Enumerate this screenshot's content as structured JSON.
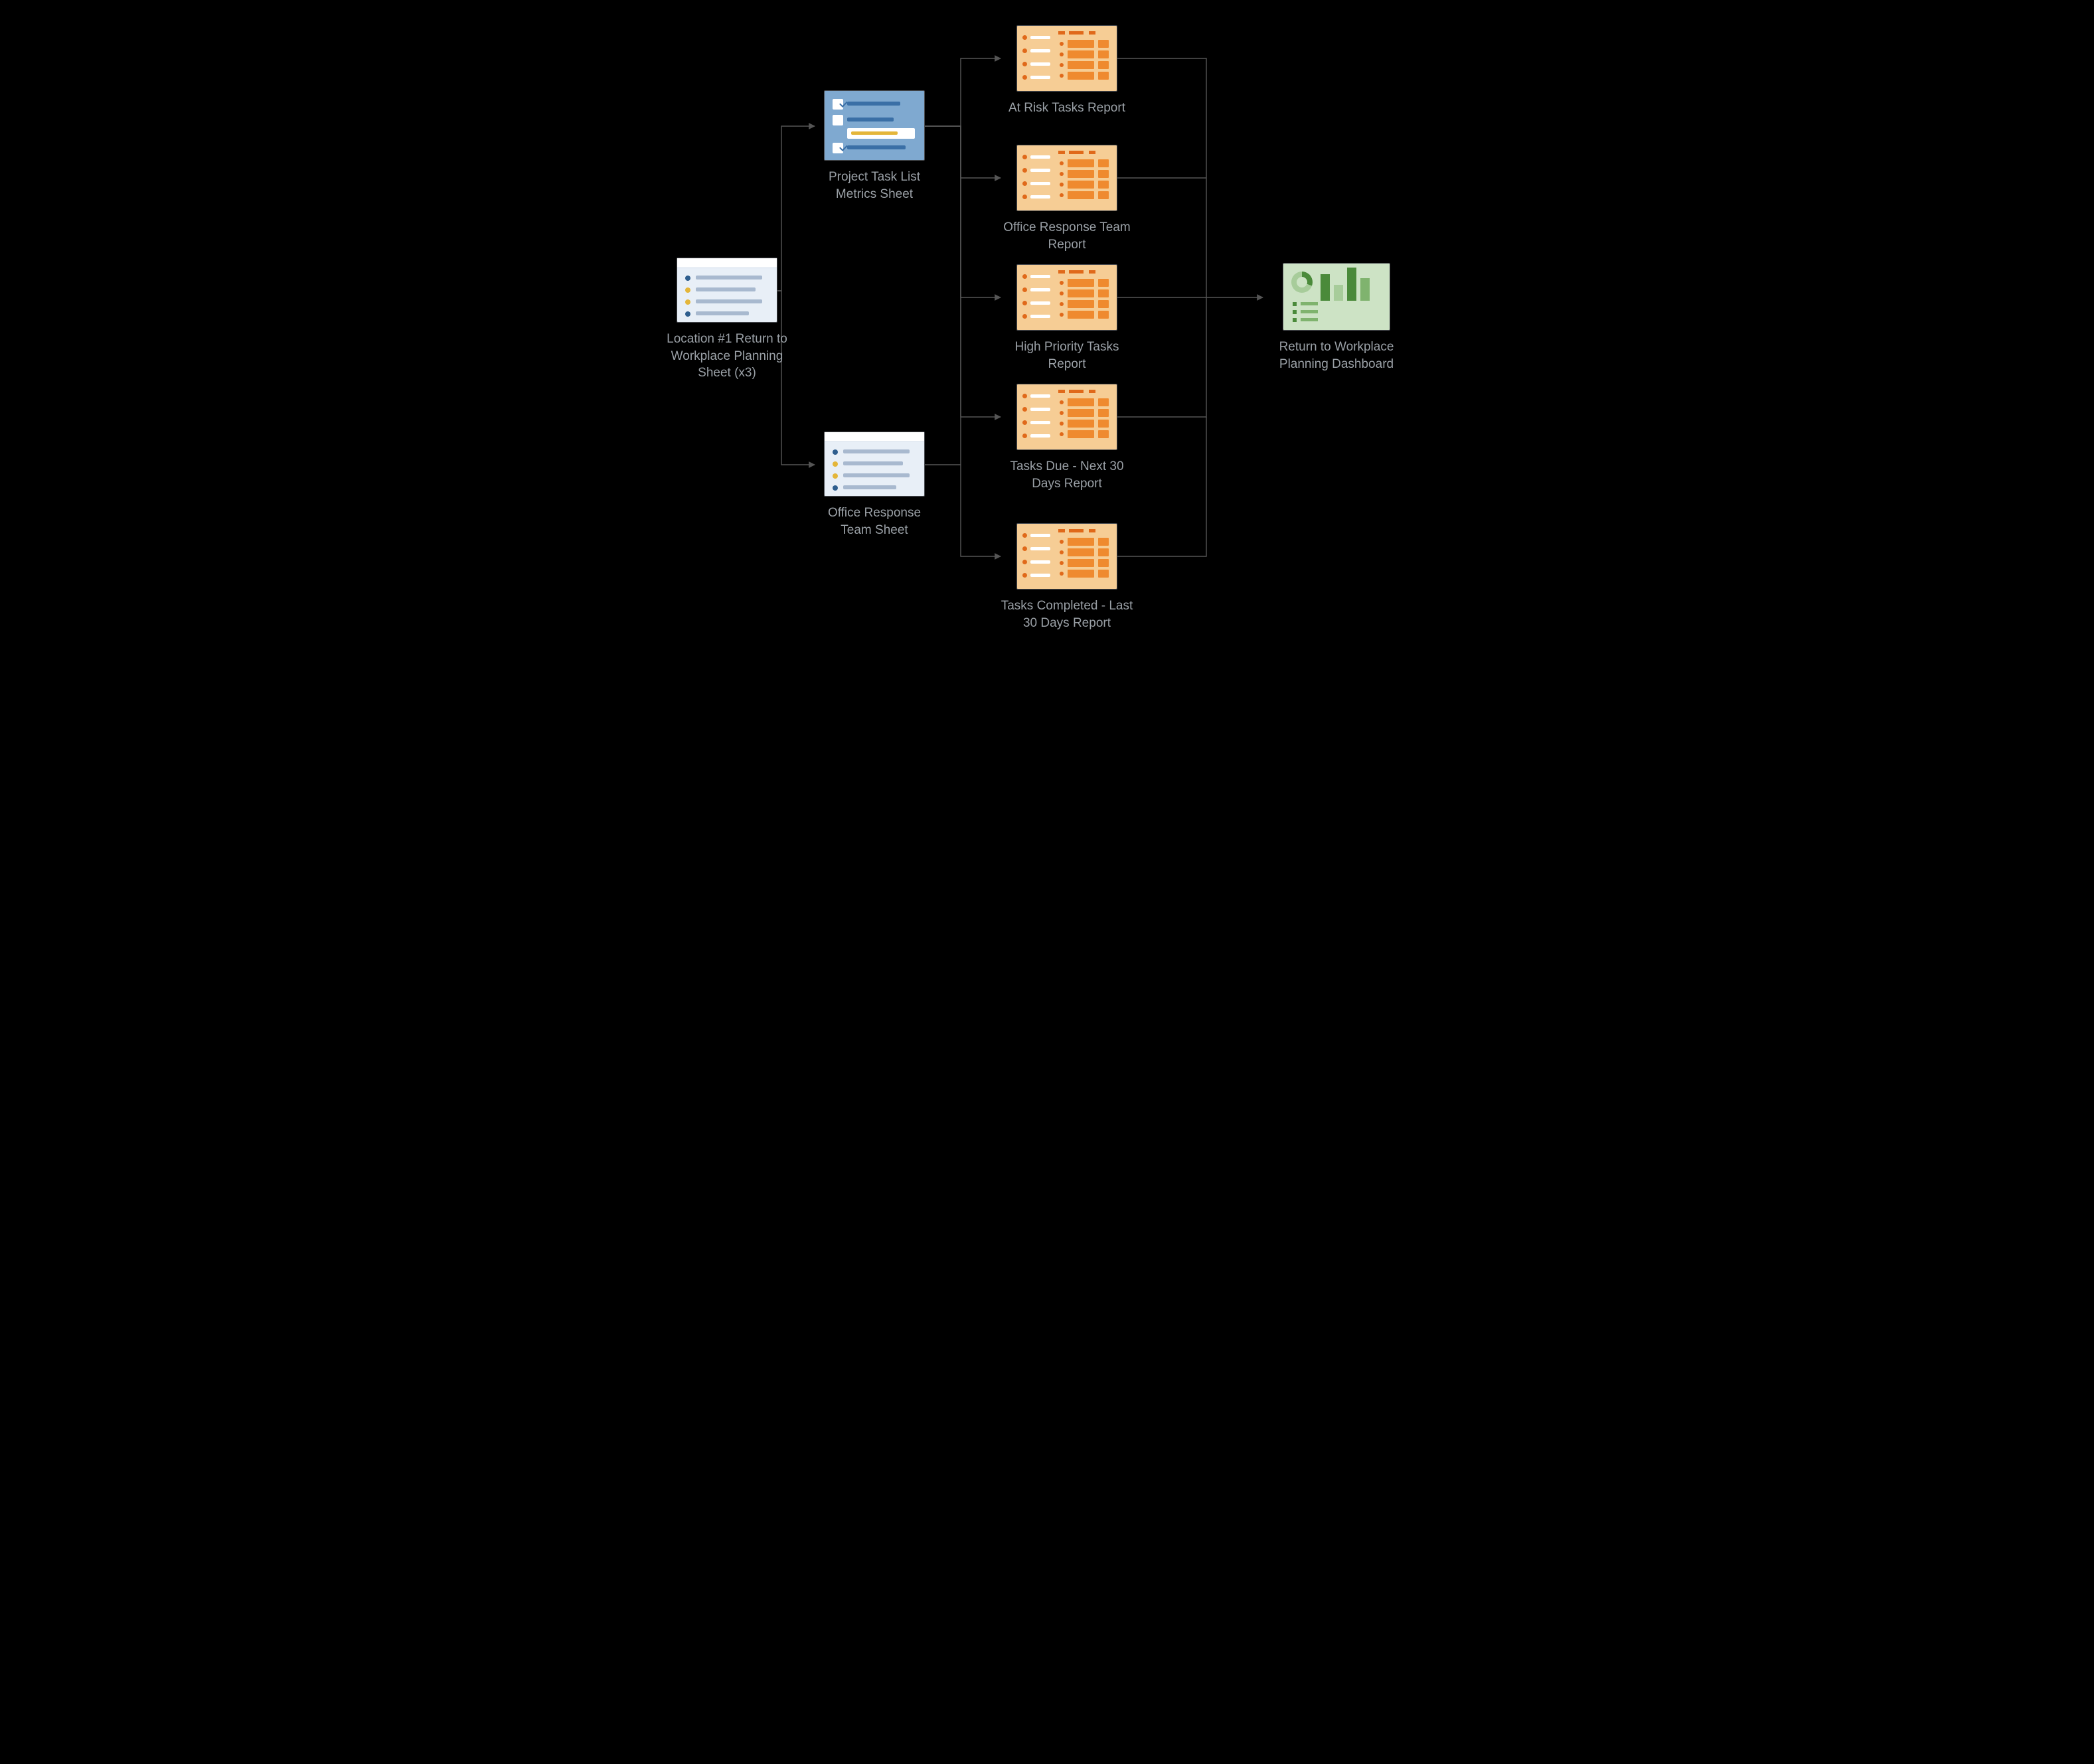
{
  "diagram": {
    "source_sheet": {
      "label": "Location #1 Return to Workplace Planning Sheet (x3)"
    },
    "metrics_sheet": {
      "label": "Project Task List Metrics Sheet"
    },
    "team_sheet": {
      "label": "Office Response Team Sheet"
    },
    "reports": {
      "at_risk": {
        "label": "At Risk Tasks Report"
      },
      "office_team": {
        "label": "Office Response Team Report"
      },
      "high_priority": {
        "label": "High Priority Tasks Report"
      },
      "due_next": {
        "label": "Tasks Due - Next 30 Days Report"
      },
      "completed_last": {
        "label": "Tasks Completed - Last 30 Days Report"
      }
    },
    "dashboard": {
      "label": "Return to Workplace Planning Dashboard"
    }
  },
  "flow": {
    "edges": [
      {
        "from": "source_sheet",
        "to": "metrics_sheet"
      },
      {
        "from": "source_sheet",
        "to": "team_sheet"
      },
      {
        "from": "metrics_sheet",
        "to": "at_risk"
      },
      {
        "from": "metrics_sheet",
        "to": "office_team"
      },
      {
        "from": "metrics_sheet",
        "to": "high_priority"
      },
      {
        "from": "metrics_sheet",
        "to": "due_next"
      },
      {
        "from": "metrics_sheet",
        "to": "completed_last"
      },
      {
        "from": "team_sheet",
        "to": "at_risk"
      },
      {
        "from": "team_sheet",
        "to": "office_team"
      },
      {
        "from": "team_sheet",
        "to": "high_priority"
      },
      {
        "from": "team_sheet",
        "to": "due_next"
      },
      {
        "from": "team_sheet",
        "to": "completed_last"
      },
      {
        "from": "at_risk",
        "to": "dashboard"
      },
      {
        "from": "office_team",
        "to": "dashboard"
      },
      {
        "from": "high_priority",
        "to": "dashboard"
      },
      {
        "from": "due_next",
        "to": "dashboard"
      },
      {
        "from": "completed_last",
        "to": "dashboard"
      }
    ]
  },
  "colors": {
    "sheet_bg": "#e8eff7",
    "checklist_bg": "#7fa9d0",
    "report_bg": "#f6cd95",
    "report_accent": "#e0691a",
    "dashboard_bg": "#cde3c5",
    "dashboard_accent": "#4a8a3a",
    "edge": "#555555",
    "text": "#9aa0a6"
  }
}
